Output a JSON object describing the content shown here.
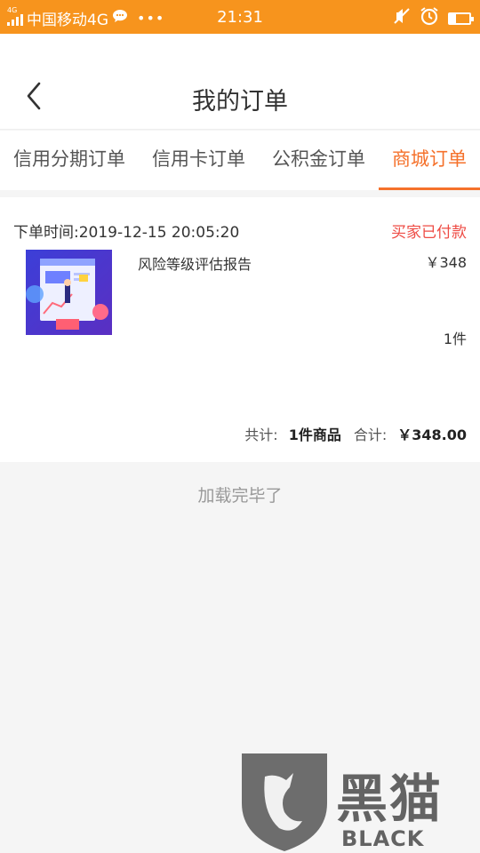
{
  "status_bar": {
    "network_tag": "4G",
    "carrier": "中国移动4G",
    "time": "21:31",
    "icons": [
      "signal-icon",
      "chat-icon",
      "more-dots-icon",
      "mute-icon",
      "alarm-icon",
      "battery-icon"
    ],
    "battery_level": 0.3
  },
  "header": {
    "title": "我的订单",
    "back_icon": "chevron-left-icon"
  },
  "tabs": [
    {
      "label": "信用分期订单",
      "active": false
    },
    {
      "label": "信用卡订单",
      "active": false
    },
    {
      "label": "公积金订单",
      "active": false
    },
    {
      "label": "商城订单",
      "active": true
    }
  ],
  "order": {
    "time_label": "下单时间:2019-12-15 20:05:20",
    "status": "买家已付款",
    "product_name": "风险等级评估报告",
    "price": "￥348",
    "quantity": "1件",
    "summary": {
      "total_label": "共计:",
      "items": "1件商品",
      "sum_label": "合计:",
      "amount": "￥348.00"
    }
  },
  "footer": {
    "load_done": "加载完毕了"
  },
  "watermark": {
    "text_cn": "黑猫",
    "text_en": "BLACK CAT"
  },
  "colors": {
    "status_bar": "#f7941d",
    "accent": "#f5712b",
    "status_paid": "#ee4b44"
  }
}
